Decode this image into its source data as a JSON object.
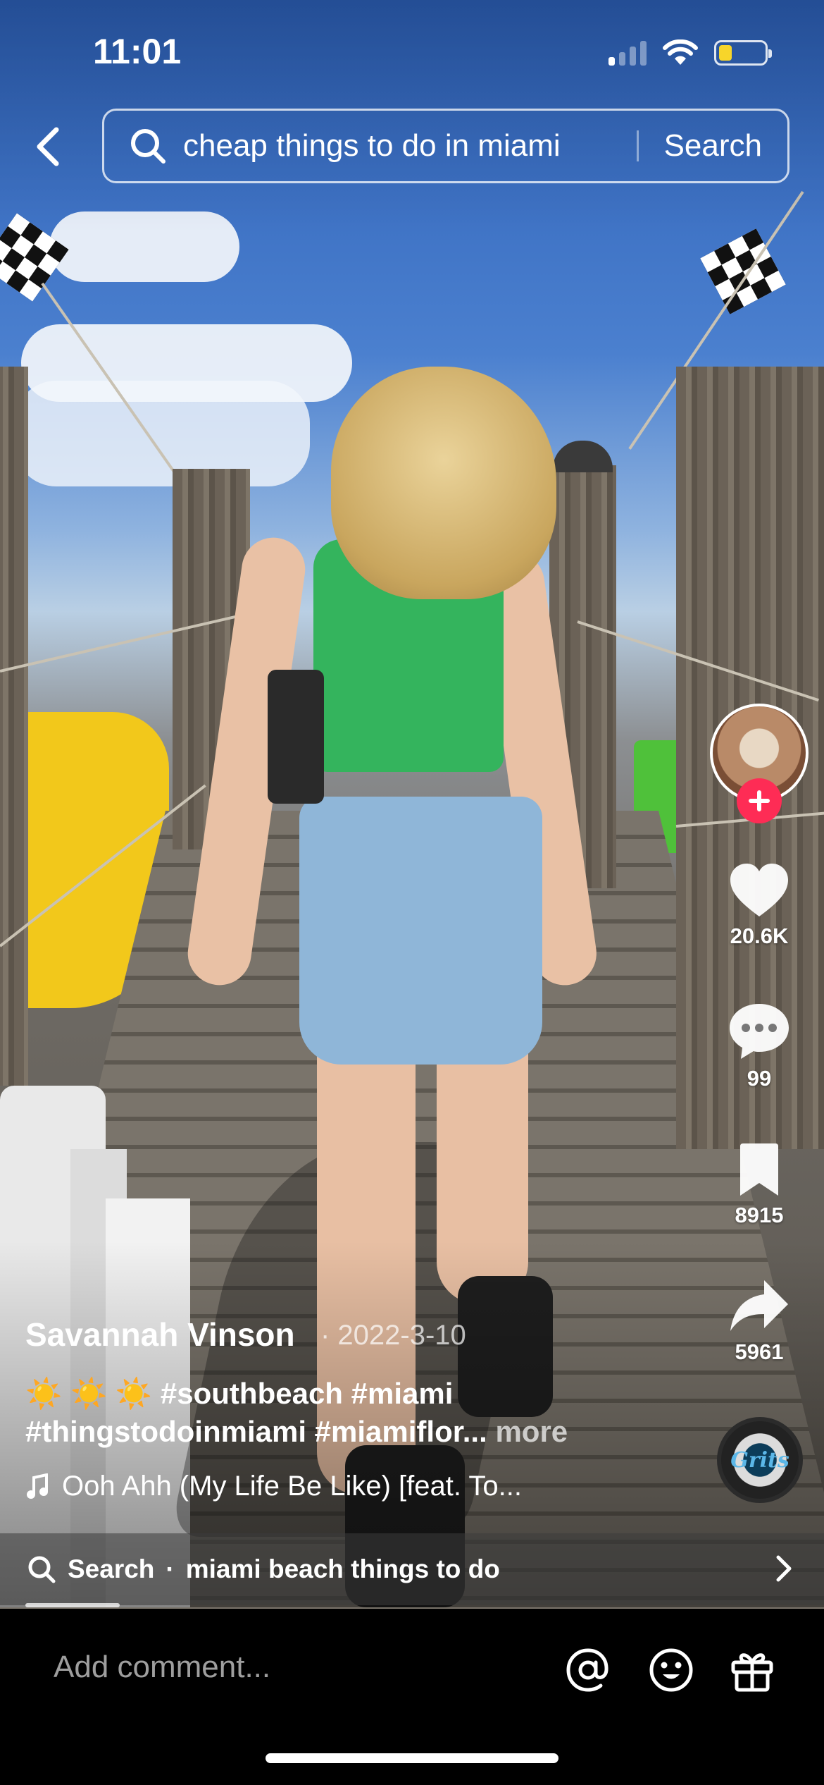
{
  "status_bar": {
    "time": "11:01"
  },
  "search": {
    "query": "cheap things to do in miami",
    "button": "Search"
  },
  "post": {
    "author": "Savannah Vinson",
    "date": "· 2022-3-10",
    "emojis": "☀️ ☀️ ☀️",
    "caption": "#southbeach #miami #thingstodoinmiami #miamiflor...",
    "more": "more",
    "music": "Ooh Ahh (My Life Be Like) [feat. To..."
  },
  "actions": {
    "likes": "20.6K",
    "comments": "99",
    "saves": "8915",
    "shares": "5961"
  },
  "disc_label": "Grits",
  "related_search": {
    "label": "Search",
    "query": "miami beach things to do"
  },
  "playback": {
    "progress": 0.13
  },
  "comment": {
    "placeholder": "Add comment..."
  },
  "colors": {
    "follow": "#fe2c55",
    "battery": "#f7d52a"
  },
  "icons": [
    "back-icon",
    "search-icon",
    "heart-icon",
    "comment-icon",
    "bookmark-icon",
    "share-icon",
    "music-note-icon",
    "chevron-right-icon",
    "at-icon",
    "emoji-icon",
    "gift-icon",
    "plus-icon"
  ]
}
